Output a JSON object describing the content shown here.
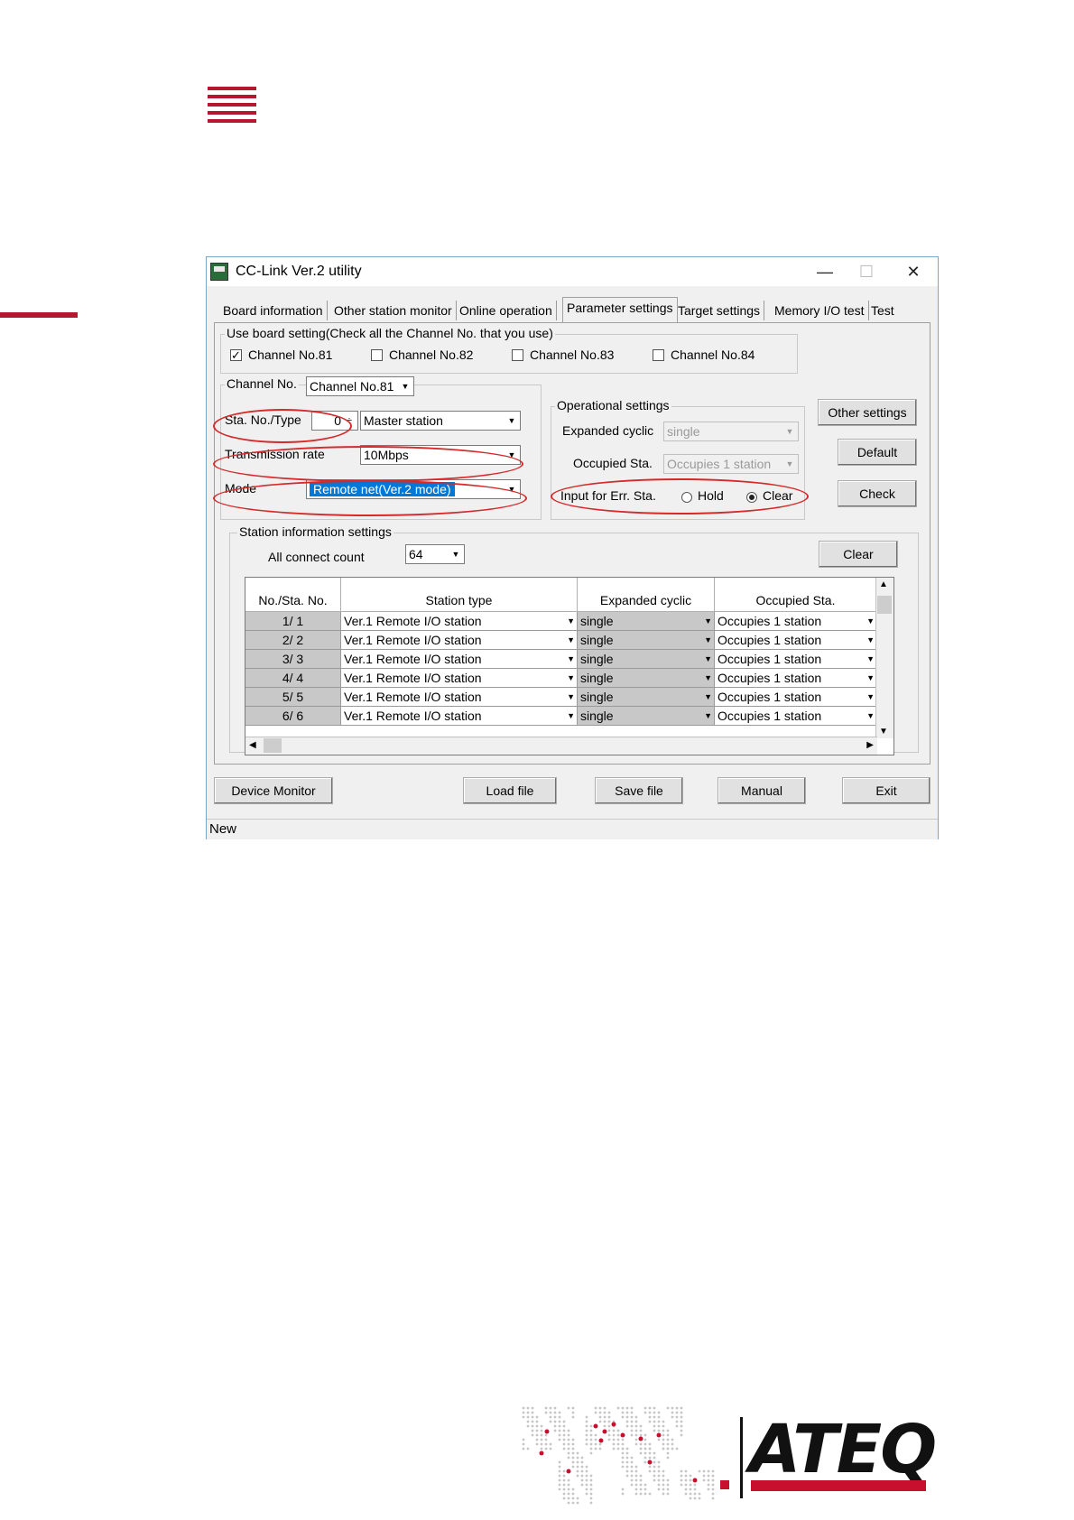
{
  "window": {
    "title": "CC-Link Ver.2 utility",
    "minimize": "—",
    "maximize": "☐",
    "close": "✕"
  },
  "tabs": [
    "Board information",
    "Other station monitor",
    "Online operation",
    "Parameter settings",
    "Target settings",
    "Memory I/O test",
    "Test"
  ],
  "active_tab": "Parameter settings",
  "board_setting": {
    "label": "Use board setting(Check all the Channel No. that you use)",
    "channels": [
      {
        "label": "Channel No.81",
        "checked": "✓"
      },
      {
        "label": "Channel No.82",
        "checked": ""
      },
      {
        "label": "Channel No.83",
        "checked": ""
      },
      {
        "label": "Channel No.84",
        "checked": ""
      }
    ]
  },
  "channel": {
    "label": "Channel No.",
    "value": "Channel No.81"
  },
  "station": {
    "sta_label": "Sta. No./Type",
    "sta_no": "0",
    "spin": "÷",
    "type": "Master station",
    "rate_label": "Transmission rate",
    "rate": "10Mbps",
    "mode_label": "Mode",
    "mode": "Remote net(Ver.2 mode)"
  },
  "operational": {
    "label": "Operational settings",
    "expanded_label": "Expanded cyclic",
    "expanded": "single",
    "occupied_label": "Occupied Sta.",
    "occupied": "Occupies 1 station",
    "input_label": "Input for Err. Sta.",
    "hold": "Hold",
    "clear": "Clear"
  },
  "side_buttons": {
    "other": "Other settings",
    "default": "Default",
    "check": "Check"
  },
  "station_info": {
    "label": "Station information settings",
    "count_label": "All connect count",
    "count": "64",
    "clear": "Clear",
    "columns": [
      "No./Sta. No.",
      "Station type",
      "Expanded cyclic",
      "Occupied Sta."
    ],
    "rows": [
      {
        "no": "1/ 1",
        "type": "Ver.1 Remote I/O station",
        "cyclic": "single",
        "occupied": "Occupies 1 station"
      },
      {
        "no": "2/ 2",
        "type": "Ver.1 Remote I/O station",
        "cyclic": "single",
        "occupied": "Occupies 1 station"
      },
      {
        "no": "3/ 3",
        "type": "Ver.1 Remote I/O station",
        "cyclic": "single",
        "occupied": "Occupies 1 station"
      },
      {
        "no": "4/ 4",
        "type": "Ver.1 Remote I/O station",
        "cyclic": "single",
        "occupied": "Occupies 1 station"
      },
      {
        "no": "5/ 5",
        "type": "Ver.1 Remote I/O station",
        "cyclic": "single",
        "occupied": "Occupies 1 station"
      },
      {
        "no": "6/ 6",
        "type": "Ver.1 Remote I/O station",
        "cyclic": "single",
        "occupied": "Occupies 1 station"
      }
    ]
  },
  "bottom_buttons": {
    "device_monitor": "Device Monitor",
    "load": "Load file",
    "save": "Save file",
    "manual": "Manual",
    "exit": "Exit"
  },
  "status": "New",
  "logo": {
    "text": "ATEQ"
  },
  "colors": {
    "accent": "#b5172f",
    "highlight": "#0078d7",
    "annotation": "#d42a2a"
  }
}
